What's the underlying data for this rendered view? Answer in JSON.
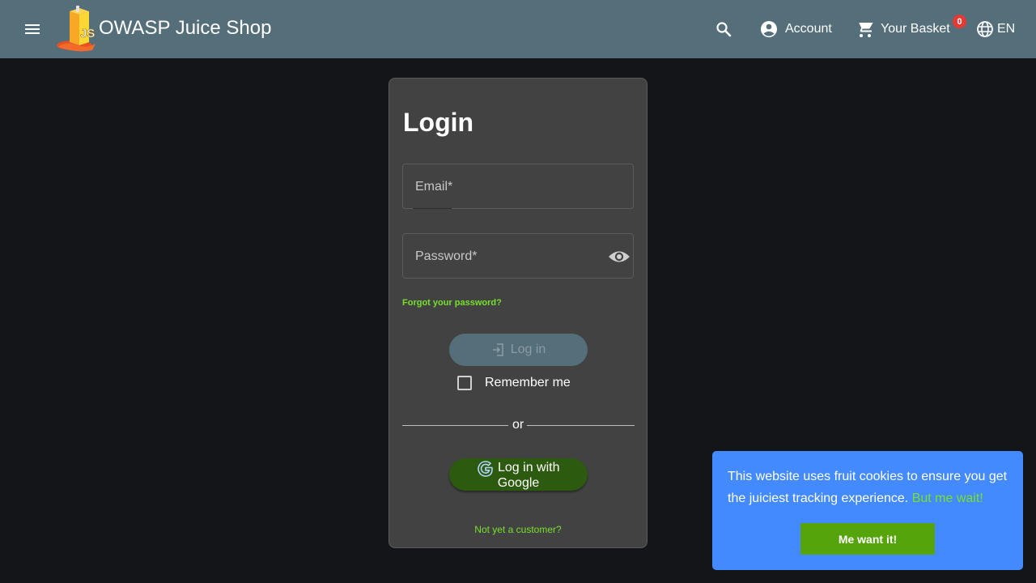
{
  "header": {
    "title": "OWASP Juice Shop",
    "logo_icon": "juice-carton-logo",
    "account_label": "Account",
    "basket_label": "Your Basket",
    "basket_count": "0",
    "language_label": "EN"
  },
  "login": {
    "title": "Login",
    "email_label": "Email*",
    "email_value": "",
    "password_label": "Password*",
    "password_value": "",
    "forgot_password": "Forgot your password?",
    "login_button": "Log in",
    "remember_me": "Remember me",
    "remember_checked": false,
    "divider_text": "or",
    "google_button_line1": "Log in with",
    "google_button_line2": "Google",
    "not_customer": "Not yet a customer?"
  },
  "cookie_banner": {
    "message": "This website uses fruit cookies to ensure you get the juiciest tracking experience.",
    "learn_more": "But me wait!",
    "dismiss_button": "Me want it!"
  },
  "colors": {
    "toolbar": "#546e7a",
    "background": "#141518",
    "card": "#424242",
    "accent_green": "#76e02c",
    "cookie_blue": "#448aff",
    "badge_red": "#e53935",
    "google_button": "#2c5a0e"
  }
}
